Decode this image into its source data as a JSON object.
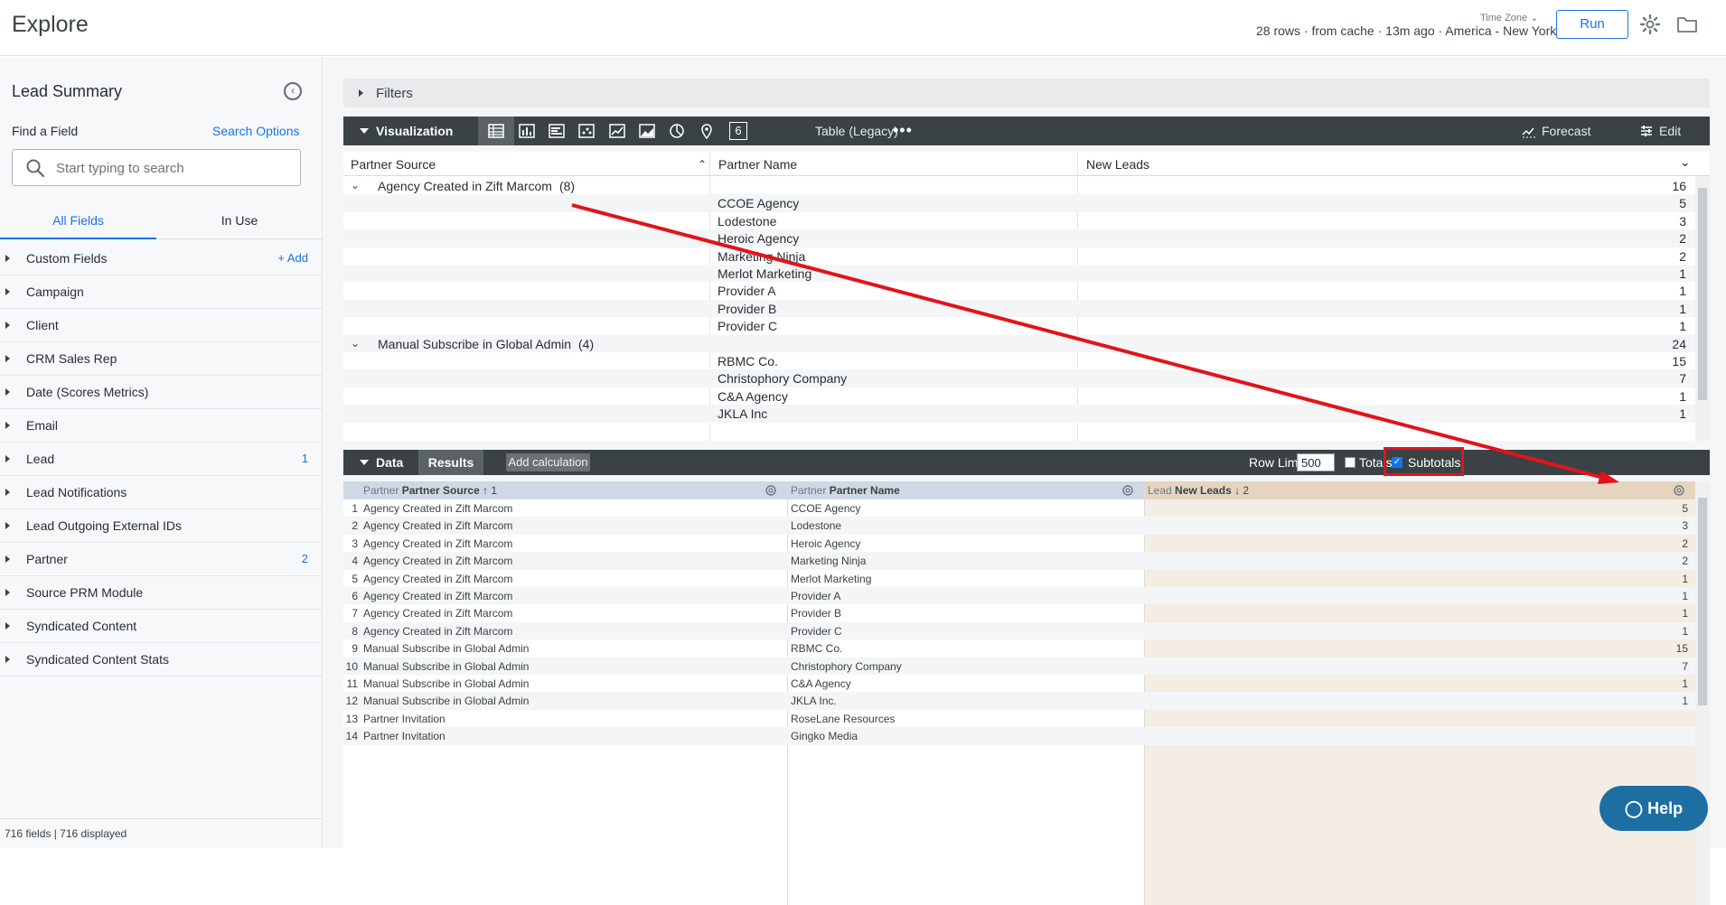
{
  "header": {
    "title": "Explore",
    "timezone_label": "Time Zone",
    "meta": "28 rows · from cache · 13m ago · America - New York",
    "run_label": "Run"
  },
  "sidebar": {
    "title": "Lead Summary",
    "find_label": "Find a Field",
    "search_options": "Search Options",
    "search_placeholder": "Start typing to search",
    "tabs": {
      "all": "All Fields",
      "in_use": "In Use"
    },
    "add_label": "+ Add",
    "items": [
      {
        "label": "Custom Fields",
        "count": ""
      },
      {
        "label": "Campaign",
        "count": ""
      },
      {
        "label": "Client",
        "count": ""
      },
      {
        "label": "CRM Sales Rep",
        "count": ""
      },
      {
        "label": "Date (Scores Metrics)",
        "count": ""
      },
      {
        "label": "Email",
        "count": ""
      },
      {
        "label": "Lead",
        "count": "1"
      },
      {
        "label": "Lead Notifications",
        "count": ""
      },
      {
        "label": "Lead Outgoing External IDs",
        "count": ""
      },
      {
        "label": "Partner",
        "count": "2"
      },
      {
        "label": "Source PRM Module",
        "count": ""
      },
      {
        "label": "Syndicated Content",
        "count": ""
      },
      {
        "label": "Syndicated Content Stats",
        "count": ""
      }
    ],
    "footer": "716 fields | 716 displayed"
  },
  "filters": {
    "label": "Filters"
  },
  "visualization": {
    "label": "Visualization",
    "type_label": "Table (Legacy)",
    "more": "•••",
    "forecast": "Forecast",
    "edit": "Edit",
    "single_value": "6",
    "columns": [
      "Partner Source",
      "Partner Name",
      "New Leads"
    ],
    "rows": [
      {
        "group": true,
        "source": "Agency Created in Zift Marcom",
        "count": "(8)",
        "name": "",
        "leads": "16"
      },
      {
        "group": false,
        "source": "",
        "name": "CCOE Agency",
        "leads": "5"
      },
      {
        "group": false,
        "source": "",
        "name": "Lodestone",
        "leads": "3"
      },
      {
        "group": false,
        "source": "",
        "name": "Heroic Agency",
        "leads": "2"
      },
      {
        "group": false,
        "source": "",
        "name": "Marketing Ninja",
        "leads": "2"
      },
      {
        "group": false,
        "source": "",
        "name": "Merlot Marketing",
        "leads": "1"
      },
      {
        "group": false,
        "source": "",
        "name": "Provider A",
        "leads": "1"
      },
      {
        "group": false,
        "source": "",
        "name": "Provider B",
        "leads": "1"
      },
      {
        "group": false,
        "source": "",
        "name": "Provider C",
        "leads": "1"
      },
      {
        "group": true,
        "source": "Manual Subscribe in Global Admin",
        "count": "(4)",
        "name": "",
        "leads": "24"
      },
      {
        "group": false,
        "source": "",
        "name": "RBMC Co.",
        "leads": "15"
      },
      {
        "group": false,
        "source": "",
        "name": "Christophory Company",
        "leads": "7"
      },
      {
        "group": false,
        "source": "",
        "name": "C&A Agency",
        "leads": "1"
      },
      {
        "group": false,
        "source": "",
        "name": "JKLA Inc",
        "leads": "1"
      }
    ]
  },
  "data_panel": {
    "label": "Data",
    "results_tab": "Results",
    "add_calculation": "Add calculation",
    "row_limit_label": "Row Limit",
    "row_limit_value": "500",
    "totals_label": "Totals",
    "subtotals_label": "Subtotals",
    "headers": [
      {
        "prefix": "Partner",
        "title": "Partner Source",
        "sort": "↑ 1"
      },
      {
        "prefix": "Partner",
        "title": "Partner Name",
        "sort": ""
      },
      {
        "prefix": "Lead",
        "title": "New Leads",
        "sort": "↓ 2"
      }
    ],
    "rows": [
      {
        "n": "1",
        "source": "Agency Created in Zift Marcom",
        "name": "CCOE Agency",
        "leads": "5"
      },
      {
        "n": "2",
        "source": "Agency Created in Zift Marcom",
        "name": "Lodestone",
        "leads": "3"
      },
      {
        "n": "3",
        "source": "Agency Created in Zift Marcom",
        "name": "Heroic Agency",
        "leads": "2"
      },
      {
        "n": "4",
        "source": "Agency Created in Zift Marcom",
        "name": "Marketing Ninja",
        "leads": "2"
      },
      {
        "n": "5",
        "source": "Agency Created in Zift Marcom",
        "name": "Merlot Marketing",
        "leads": "1"
      },
      {
        "n": "6",
        "source": "Agency Created in Zift Marcom",
        "name": "Provider A",
        "leads": "1"
      },
      {
        "n": "7",
        "source": "Agency Created in Zift Marcom",
        "name": "Provider B",
        "leads": "1"
      },
      {
        "n": "8",
        "source": "Agency Created in Zift Marcom",
        "name": "Provider C",
        "leads": "1"
      },
      {
        "n": "9",
        "source": "Manual Subscribe in Global Admin",
        "name": "RBMC Co.",
        "leads": "15"
      },
      {
        "n": "10",
        "source": "Manual Subscribe in Global Admin",
        "name": "Christophory Company",
        "leads": "7"
      },
      {
        "n": "11",
        "source": "Manual Subscribe in Global Admin",
        "name": "C&A Agency",
        "leads": "1"
      },
      {
        "n": "12",
        "source": "Manual Subscribe in Global Admin",
        "name": "JKLA Inc.",
        "leads": "1"
      },
      {
        "n": "13",
        "source": "Partner Invitation",
        "name": "RoseLane Resources",
        "leads": ""
      },
      {
        "n": "14",
        "source": "Partner Invitation",
        "name": "Gingko Media",
        "leads": ""
      }
    ]
  },
  "help": {
    "label": "Help"
  },
  "colors": {
    "accent": "#1a73e8",
    "bar": "#3a4245",
    "annotation": "#e2131b",
    "help": "#1d6fa3"
  }
}
